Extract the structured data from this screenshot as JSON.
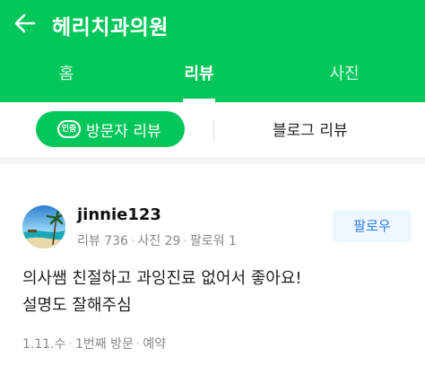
{
  "header": {
    "title": "헤리치과의원",
    "back_icon": "arrow-left-icon",
    "background_color": "#03c75a"
  },
  "tabs": [
    {
      "label": "홈",
      "active": false
    },
    {
      "label": "리뷰",
      "active": true
    },
    {
      "label": "사진",
      "active": false
    }
  ],
  "subtabs": {
    "visitor_review": {
      "badge": "인증",
      "label": "방문자 리뷰",
      "selected": true
    },
    "blog_review": {
      "label": "블로그 리뷰",
      "selected": false
    }
  },
  "review": {
    "avatar_icon": "beach-photo-avatar",
    "username": "jinnie123",
    "stats": [
      "리뷰 736",
      "사진 29",
      "팔로워 1"
    ],
    "follow_label": "팔로우",
    "text_lines": [
      "의사쌤 친절하고 과잉진료 없어서 좋아요!",
      "설명도 잘해주심"
    ],
    "footer": [
      "1.11.수",
      "1번째 방문",
      "예약"
    ]
  }
}
